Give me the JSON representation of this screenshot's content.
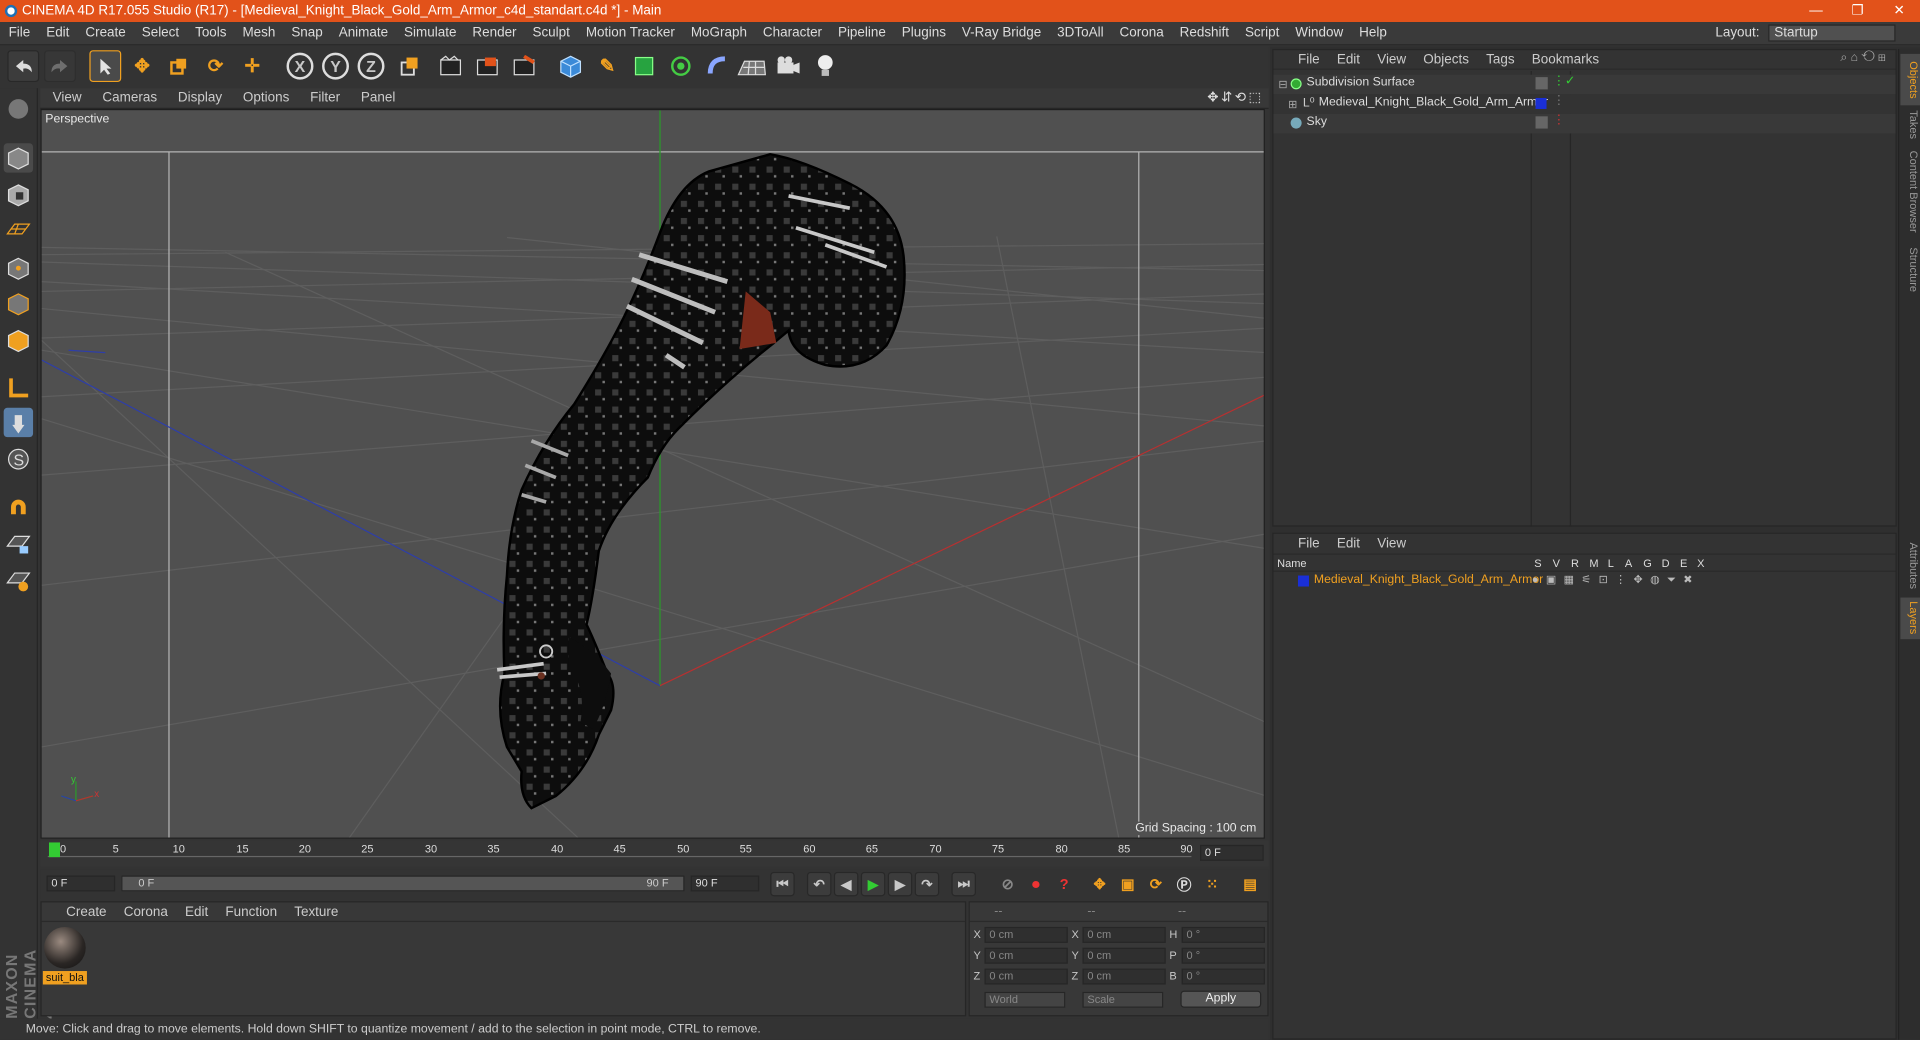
{
  "titlebar": {
    "title": "CINEMA 4D R17.055 Studio (R17) - [Medieval_Knight_Black_Gold_Arm_Armor_c4d_standart.c4d *] - Main",
    "min": "—",
    "max": "❐",
    "close": "✕"
  },
  "menu": [
    "File",
    "Edit",
    "Create",
    "Select",
    "Tools",
    "Mesh",
    "Snap",
    "Animate",
    "Simulate",
    "Render",
    "Sculpt",
    "Motion Tracker",
    "MoGraph",
    "Character",
    "Pipeline",
    "Plugins",
    "V-Ray Bridge",
    "3DToAll",
    "Corona",
    "Redshift",
    "Script",
    "Window",
    "Help"
  ],
  "layout": {
    "label": "Layout:",
    "value": "Startup"
  },
  "toolbar": {
    "x_axis": "X",
    "y_axis": "Y",
    "z_axis": "Z"
  },
  "viewport": {
    "menu": [
      "View",
      "Cameras",
      "Display",
      "Options",
      "Filter",
      "Panel"
    ],
    "camera_label": "Perspective",
    "grid_spacing": "Grid Spacing : 100 cm",
    "axis_x": "x",
    "axis_y": "y"
  },
  "timeline": {
    "ticks": [
      "0",
      "5",
      "10",
      "15",
      "20",
      "25",
      "30",
      "35",
      "40",
      "45",
      "50",
      "55",
      "60",
      "65",
      "70",
      "75",
      "80",
      "85",
      "90"
    ],
    "current_frame": "0 F"
  },
  "transport": {
    "start_frame": "0 F",
    "range_start": "0 F",
    "range_end": "90 F",
    "end_frame": "90 F"
  },
  "material_panel": {
    "menu": [
      "Create",
      "Corona",
      "Edit",
      "Function",
      "Texture"
    ],
    "material_name": "suit_bla"
  },
  "coordinates": {
    "header": [
      "--",
      "--",
      "--"
    ],
    "rows": [
      {
        "a": "X",
        "av": "0 cm",
        "b": "X",
        "bv": "0 cm",
        "c": "H",
        "cv": "0 °"
      },
      {
        "a": "Y",
        "av": "0 cm",
        "b": "Y",
        "bv": "0 cm",
        "c": "P",
        "cv": "0 °"
      },
      {
        "a": "Z",
        "av": "0 cm",
        "b": "Z",
        "bv": "0 cm",
        "c": "B",
        "cv": "0 °"
      }
    ],
    "mode": "World",
    "transform": "Scale",
    "apply": "Apply"
  },
  "status": "Move: Click and drag to move elements. Hold down SHIFT to quantize movement / add to the selection in point mode, CTRL to remove.",
  "object_manager": {
    "menu": [
      "File",
      "Edit",
      "View",
      "Objects",
      "Tags",
      "Bookmarks"
    ],
    "objects": [
      {
        "name": "Subdivision Surface"
      },
      {
        "name": "Medieval_Knight_Black_Gold_Arm_Armor"
      },
      {
        "name": "Sky"
      }
    ]
  },
  "layer_manager": {
    "menu": [
      "File",
      "Edit",
      "View"
    ],
    "columns": [
      "Name",
      "S",
      "V",
      "R",
      "M",
      "L",
      "A",
      "G",
      "D",
      "E",
      "X"
    ],
    "layer": "Medieval_Knight_Black_Gold_Arm_Armor"
  },
  "side_tabs": [
    "Objects",
    "Takes",
    "Content Browser",
    "Structure",
    "Attributes",
    "Layers"
  ],
  "brand": "MAXON CINEMA 4D",
  "colors": {
    "accent": "#e2521a",
    "layer_blue": "#1a2fd6",
    "material_highlight": "#f0a020"
  }
}
